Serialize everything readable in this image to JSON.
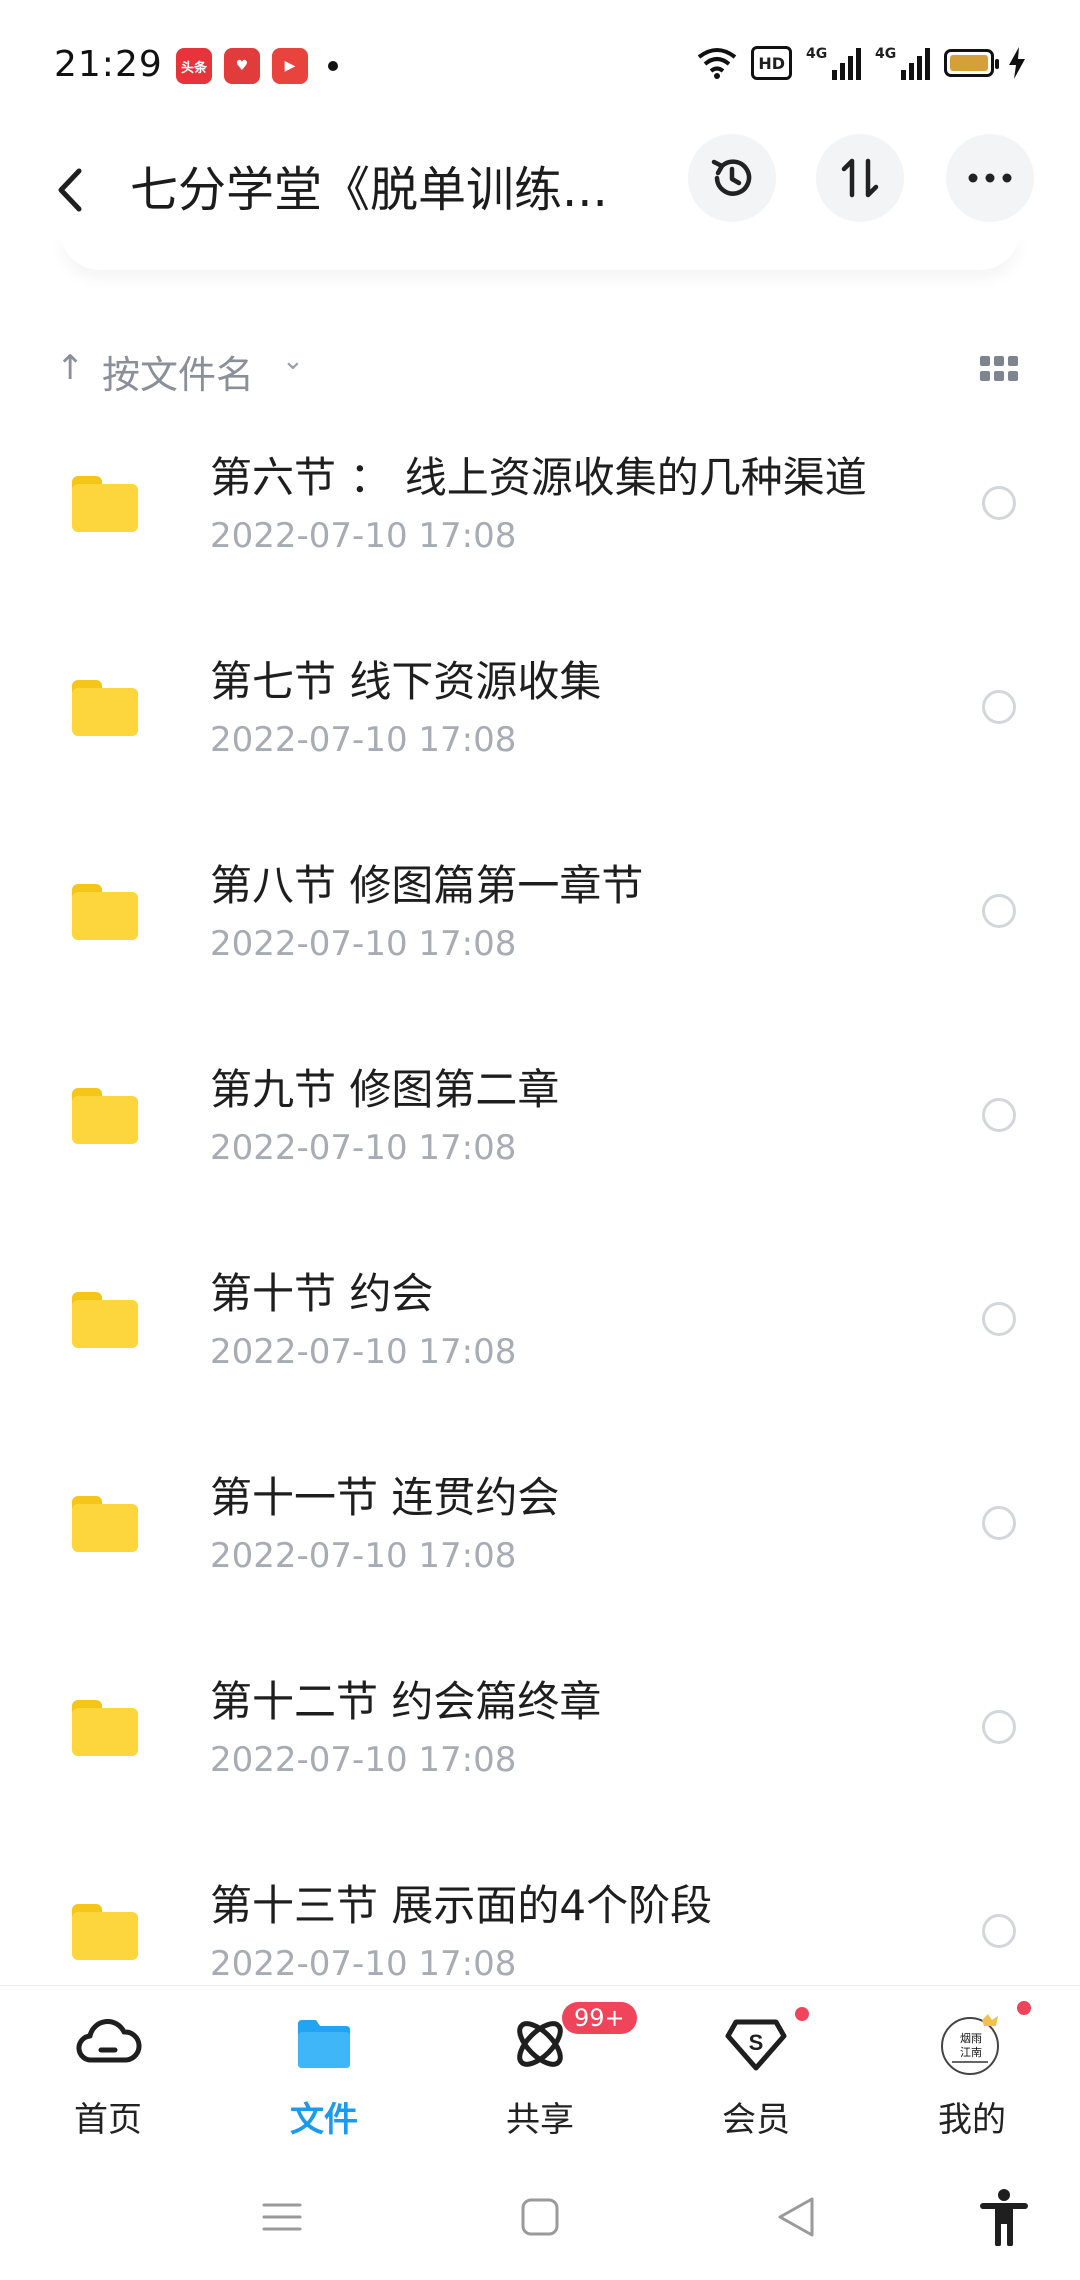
{
  "status_bar": {
    "time": "21:29",
    "apps": [
      "头条",
      "♥",
      "▶"
    ],
    "hd_label": "HD",
    "network_1": "4G",
    "network_2": "4G"
  },
  "header": {
    "title": "七分学堂《脱单训练...",
    "icons": [
      "back-icon",
      "history-icon",
      "sort-icon",
      "more-icon"
    ]
  },
  "sort": {
    "arrow": "↑",
    "label": "按文件名",
    "caret": "⌄"
  },
  "files": [
    {
      "name": "第六节 ： 线上资源收集的几种渠道",
      "date": "2022-07-10  17:08"
    },
    {
      "name": "第七节 线下资源收集",
      "date": "2022-07-10  17:08"
    },
    {
      "name": "第八节 修图篇第一章节",
      "date": "2022-07-10  17:08"
    },
    {
      "name": "第九节 修图第二章",
      "date": "2022-07-10  17:08"
    },
    {
      "name": "第十节  约会",
      "date": "2022-07-10  17:08"
    },
    {
      "name": "第十一节  连贯约会",
      "date": "2022-07-10  17:08"
    },
    {
      "name": "第十二节  约会篇终章",
      "date": "2022-07-10  17:08"
    },
    {
      "name": "第十三节  展示面的4个阶段",
      "date": "2022-07-10  17:08"
    }
  ],
  "tabs": [
    {
      "label": "首页",
      "icon": "cloud-icon",
      "active": false
    },
    {
      "label": "文件",
      "icon": "folder-icon",
      "active": true
    },
    {
      "label": "共享",
      "icon": "share-orbit-icon",
      "active": false,
      "badge": "99+"
    },
    {
      "label": "会员",
      "icon": "vip-diamond-icon",
      "active": false
    },
    {
      "label": "我的",
      "icon": "avatar-icon",
      "active": false,
      "avatar_text": [
        "烟雨",
        "江南"
      ]
    }
  ],
  "colors": {
    "accent": "#1b9bf0",
    "folder": "#fdd53c",
    "badge": "#f0445a"
  }
}
